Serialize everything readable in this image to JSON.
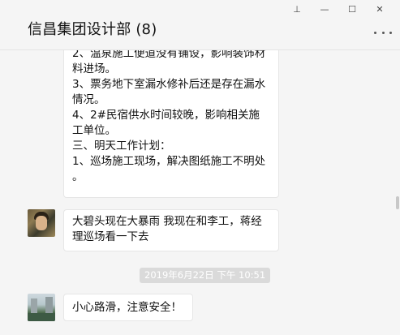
{
  "window": {
    "title": "信昌集团设计部 (8)",
    "controls": [
      "pin",
      "minimize",
      "maximize",
      "close"
    ],
    "control_glyphs": {
      "pin": "⊥",
      "minimize": "—",
      "maximize": "☐",
      "close": "✕"
    },
    "more_label": "…"
  },
  "messages": [
    {
      "id": "msg1",
      "lines": [
        "2、温泉施工便道没有铺设，影响装饰材",
        "料进场。",
        "3、票务地下室漏水修补后还是存在漏水",
        "情况。",
        "4、2#民宿供水时间较晚，影响相关施",
        "工单位。",
        "三、明天工作计划：",
        "1、巡场施工现场，解决图纸施工不明处",
        "。"
      ]
    },
    {
      "id": "msg2",
      "text_line1": "大碧头现在大暴雨 我现在和李工，蒋经",
      "text_line2": "理巡场看一下去"
    },
    {
      "id": "msg3",
      "text": "小心路滑，注意安全！"
    }
  ],
  "timestamp": "2019年6月22日 下午 10:51",
  "colors": {
    "background": "#f5f5f5",
    "bubble": "#ffffff",
    "timestamp_bg": "#dadada"
  }
}
